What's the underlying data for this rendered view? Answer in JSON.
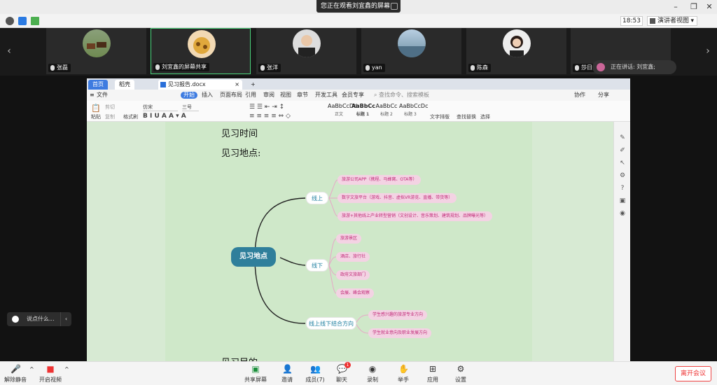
{
  "banner": {
    "text": "您正在观看刘宜鑫的屏幕"
  },
  "meeting": {
    "time": "18:53",
    "view_mode": "演讲者视图"
  },
  "participants": [
    {
      "name": "张磊",
      "avatar": "horses"
    },
    {
      "name": "刘宜鑫的屏幕共享",
      "avatar": "giraffe"
    },
    {
      "name": "张洋",
      "avatar": "man-suit"
    },
    {
      "name": "yan",
      "avatar": "lake"
    },
    {
      "name": "陈森",
      "avatar": "woman"
    },
    {
      "name": "莎日娜",
      "avatar": "landscape"
    }
  ],
  "speaking": {
    "text": "正在讲话: 刘宜鑫;"
  },
  "wps": {
    "tabs": [
      "首页",
      "稻壳",
      "见习报告.docx"
    ],
    "menu": [
      "文件",
      "开始",
      "插入",
      "页面布局",
      "引用",
      "审阅",
      "视图",
      "章节",
      "开发工具",
      "会员专享"
    ],
    "search_placeholder": "查找命令、搜索模板",
    "right_actions": [
      "协作",
      "分享"
    ],
    "ribbon": {
      "clipboard": [
        "粘贴",
        "剪切",
        "复制",
        "格式刷"
      ],
      "font": "仿宋",
      "size": "三号",
      "styles": [
        {
          "sample": "AaBbCcDd",
          "label": "正文"
        },
        {
          "sample": "AaBbCc",
          "label": "标题 1"
        },
        {
          "sample": "AaBbCc",
          "label": "标题 2"
        },
        {
          "sample": "AaBbCcDc",
          "label": "标题 3"
        }
      ],
      "tools": [
        "文字排版",
        "查找替换",
        "选择"
      ]
    }
  },
  "document": {
    "heading1": "见习时间",
    "heading2": "见习地点:",
    "heading3": "见习目的",
    "mindmap": {
      "root": "见习地点",
      "branches": [
        {
          "label": "线上",
          "leaves": [
            "旅游公司APP（携程、马蜂窝、OTA等）",
            "数字文旅平台（游戏、抖音、虚拟VR游览、直播、带货等）",
            "旅游+其他线上产业转型营销（文创设计、音乐策划、建筑规划、品牌曝光等）"
          ]
        },
        {
          "label": "线下",
          "leaves": [
            "旅游景区",
            "酒店、旅行社",
            "政府文旅部门",
            "会展、峰会观察"
          ]
        },
        {
          "label": "线上线下结合方向",
          "leaves": [
            "学生感兴趣的旅游专业方向",
            "学生就业意向及职业发展方向"
          ]
        }
      ]
    }
  },
  "chat": {
    "placeholder": "说点什么..."
  },
  "toolbar": {
    "left": [
      {
        "label": "解除静音",
        "icon": "mic-off-icon"
      },
      {
        "label": "开启视频",
        "icon": "video-off-icon"
      }
    ],
    "center": [
      {
        "label": "共享屏幕",
        "icon": "screen-share-icon"
      },
      {
        "label": "邀请",
        "icon": "invite-icon"
      },
      {
        "label": "成员(7)",
        "icon": "members-icon"
      },
      {
        "label": "聊天",
        "icon": "chat-icon",
        "badge": "1"
      },
      {
        "label": "录制",
        "icon": "record-icon"
      },
      {
        "label": "举手",
        "icon": "raise-hand-icon"
      },
      {
        "label": "应用",
        "icon": "apps-icon"
      },
      {
        "label": "设置",
        "icon": "settings-icon"
      }
    ],
    "leave": "离开会议"
  }
}
